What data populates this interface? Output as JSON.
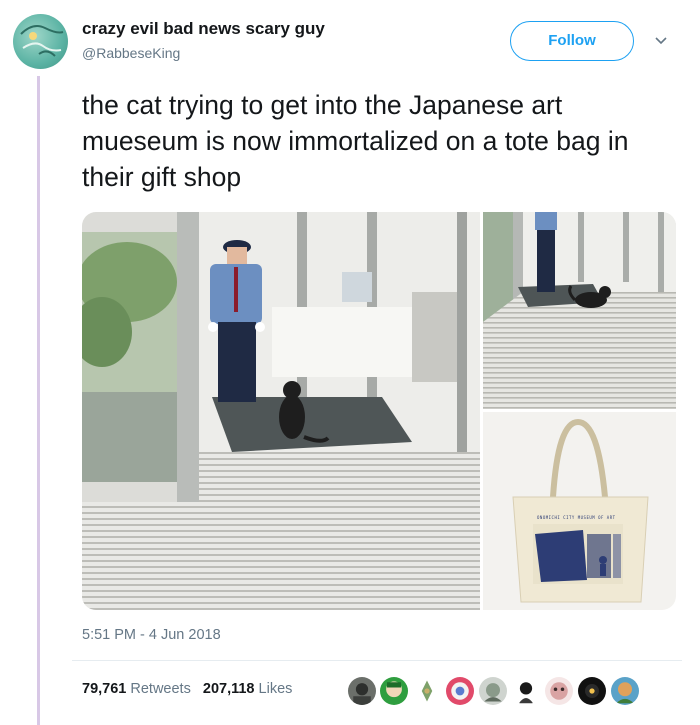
{
  "user": {
    "display_name": "crazy evil bad news scary guy",
    "handle": "@RabbeseKing",
    "avatar_icon": "profile-avatar"
  },
  "follow_label": "Follow",
  "tweet": {
    "text": "the cat trying to get into the Japanese art mueseum is now immortalized on a tote bag in their gift shop",
    "timestamp": "5:51 PM - 4 Jun 2018"
  },
  "media": {
    "tote_print_text": "ONOMICHI CITY MUSEUM OF ART"
  },
  "stats": {
    "retweets_count": "79,761",
    "retweets_label": "Retweets",
    "likes_count": "207,118",
    "likes_label": "Likes"
  },
  "likers": [
    "liker-1",
    "liker-2",
    "liker-3",
    "liker-4",
    "liker-5",
    "liker-6",
    "liker-7",
    "liker-8",
    "liker-9",
    "liker-10"
  ],
  "colors": {
    "accent": "#1da1f2",
    "muted": "#657786",
    "thread_line": "#d8c8e6"
  }
}
